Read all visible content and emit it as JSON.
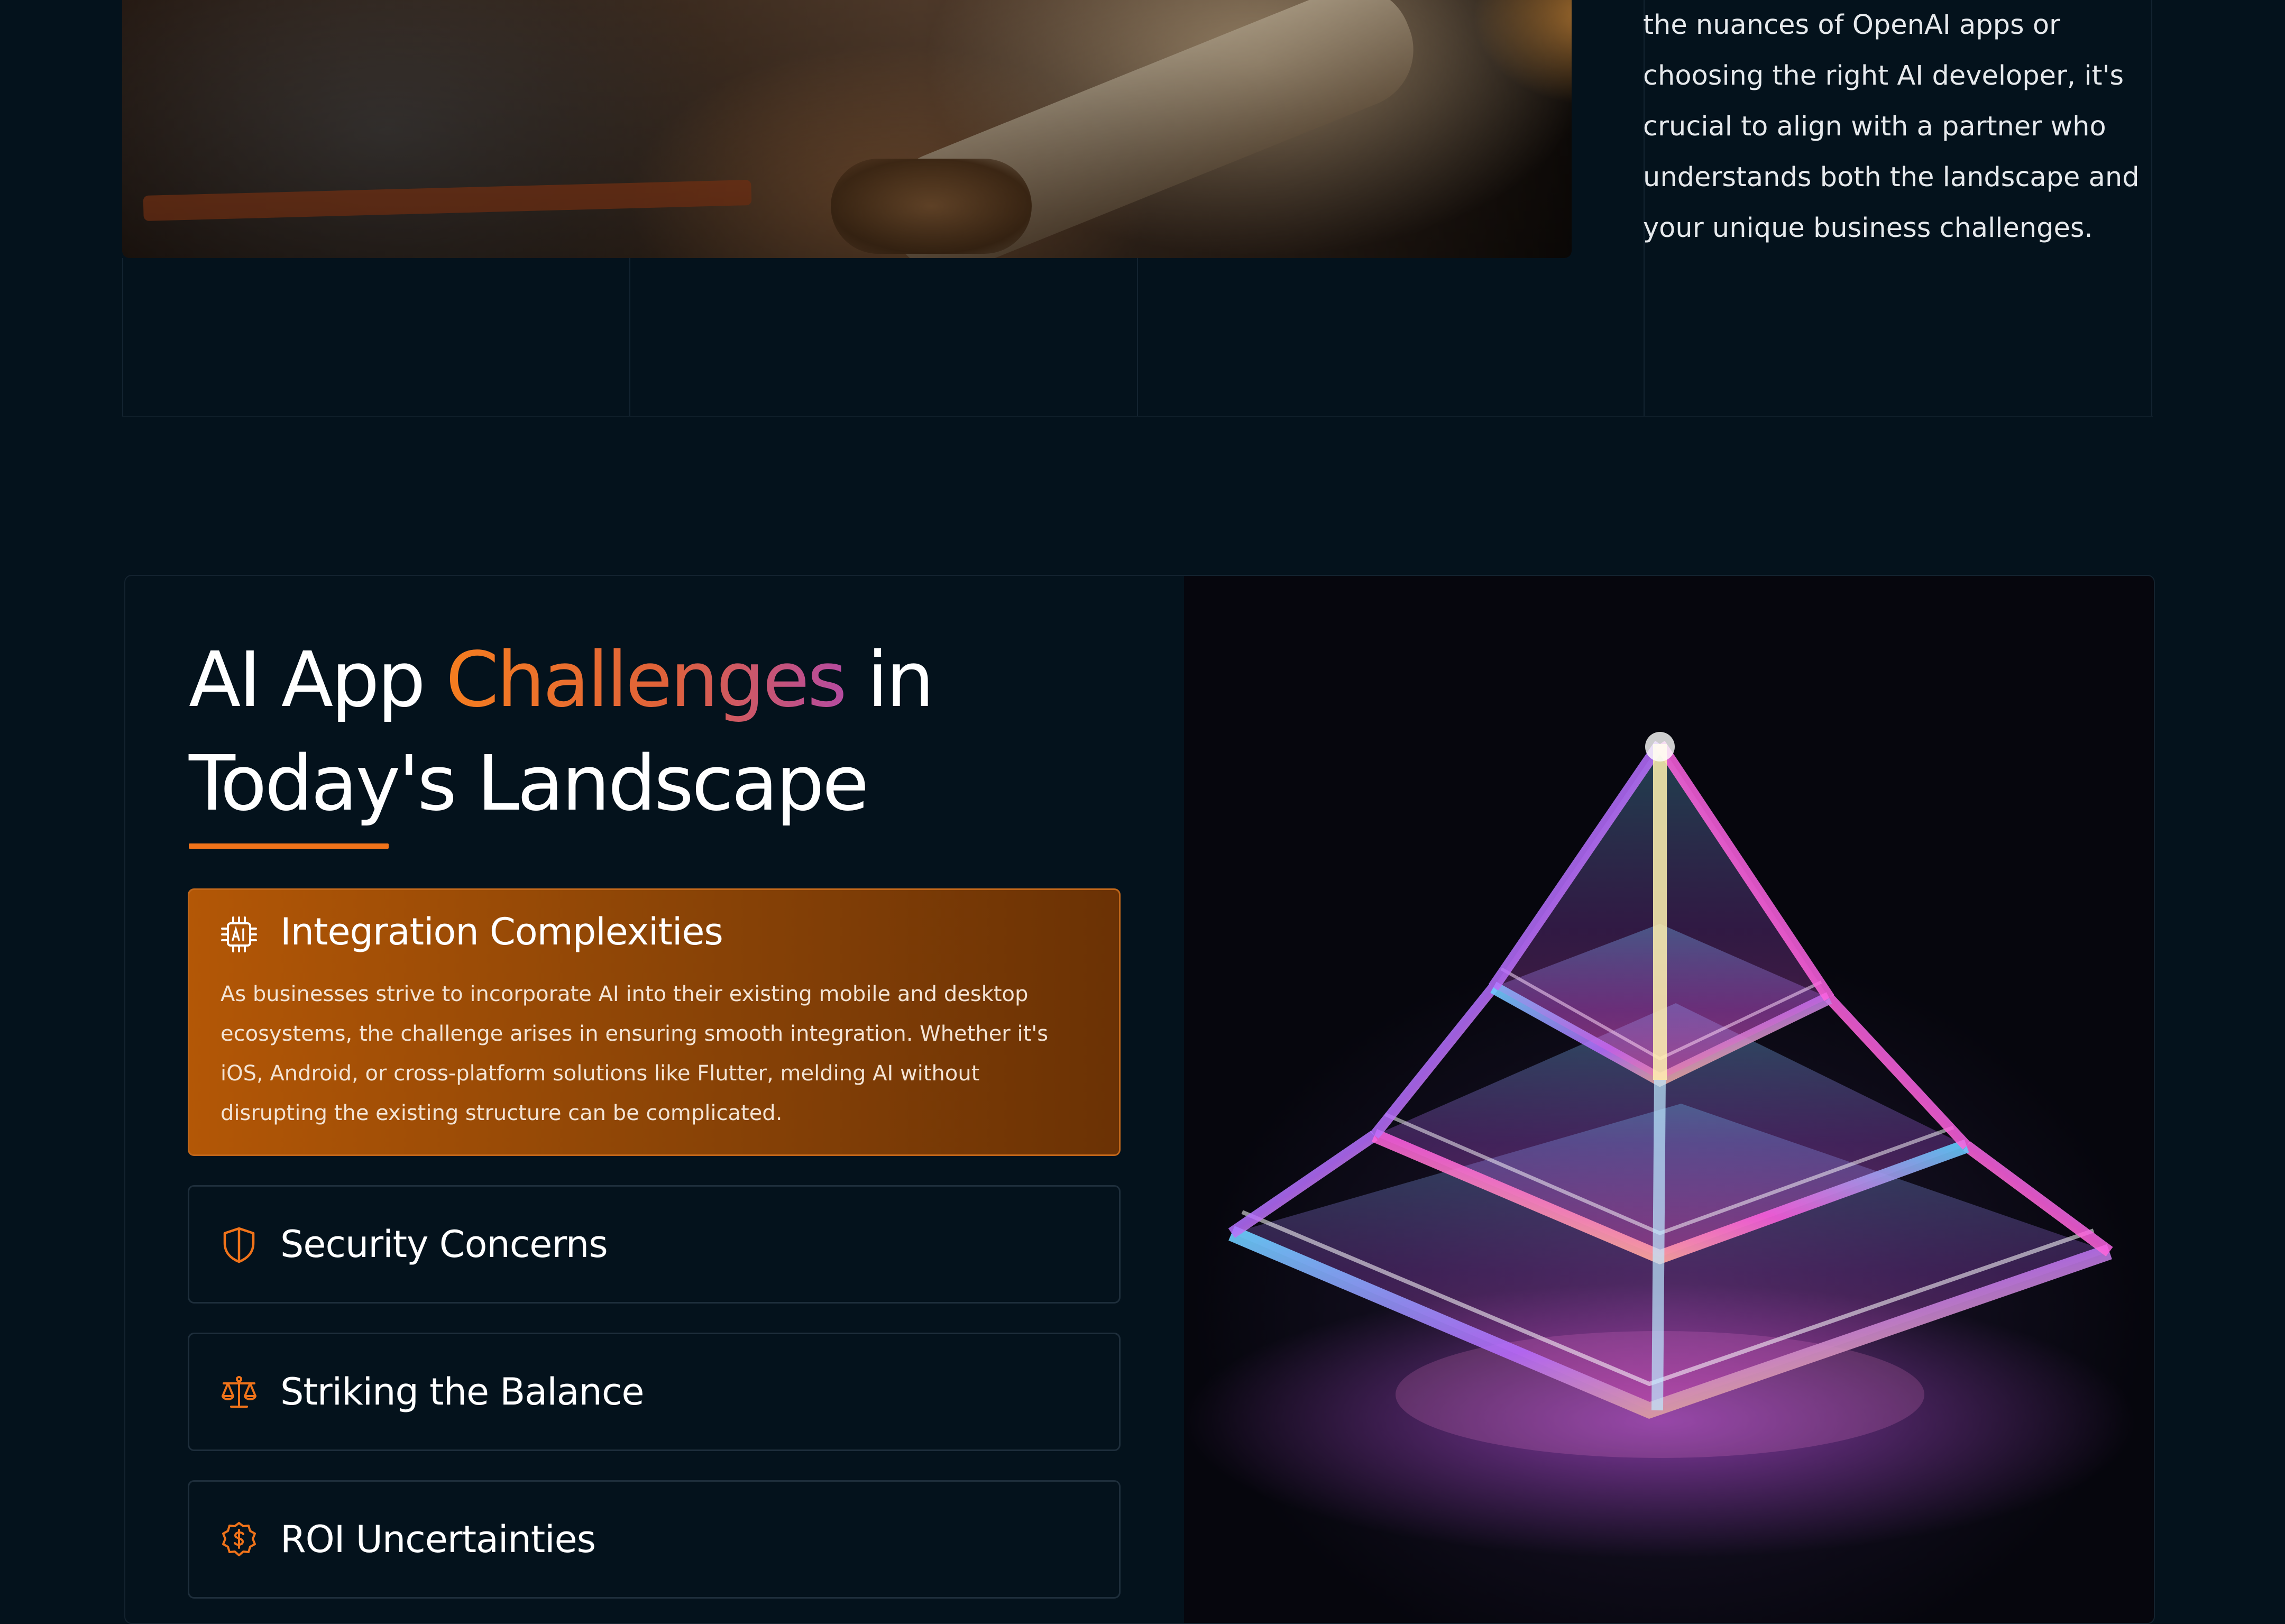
{
  "intro": {
    "paragraph": "the nuances of OpenAI apps or choosing the right AI developer, it's crucial to align with a partner who understands both the landscape and your unique business challenges."
  },
  "challenges": {
    "title_part1": "AI App ",
    "title_highlight": "Challenges",
    "title_part2": " in Today's Landscape",
    "accent_color": "#f0731a",
    "items": [
      {
        "icon": "ai-chip-icon",
        "title": "Integration Complexities",
        "body": "As businesses strive to incorporate AI into their existing mobile and desktop ecosystems, the challenge arises in ensuring smooth integration. Whether it's iOS, Android, or cross-platform solutions like Flutter, melding AI without disrupting the existing structure can be complicated.",
        "expanded": true
      },
      {
        "icon": "shield-icon",
        "title": "Security Concerns",
        "expanded": false
      },
      {
        "icon": "scales-icon",
        "title": "Striking the Balance",
        "expanded": false
      },
      {
        "icon": "dollar-coin-icon",
        "title": "ROI Uncertainties",
        "expanded": false
      }
    ]
  }
}
